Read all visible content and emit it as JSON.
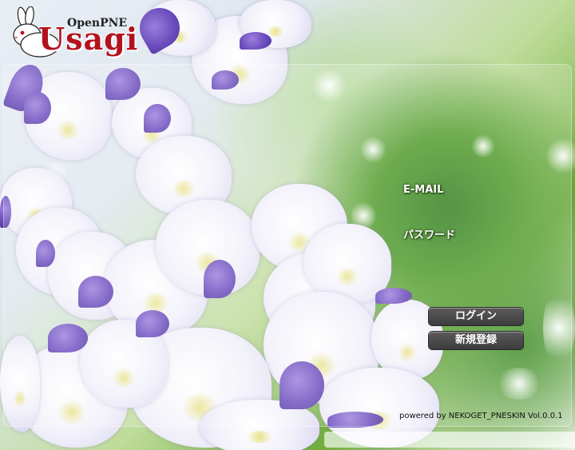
{
  "logo": {
    "sub": "OpenPNE",
    "main": "Usagi"
  },
  "form": {
    "email_label": "E-MAIL",
    "password_label": "パスワード"
  },
  "buttons": {
    "login": "ログイン",
    "register": "新規登録"
  },
  "footer": {
    "powered": "powered by NEKOGET_PNESKIN Vol.0.0.1"
  },
  "colors": {
    "logo_red": "#b3121d",
    "button": "#4a4a4a"
  }
}
